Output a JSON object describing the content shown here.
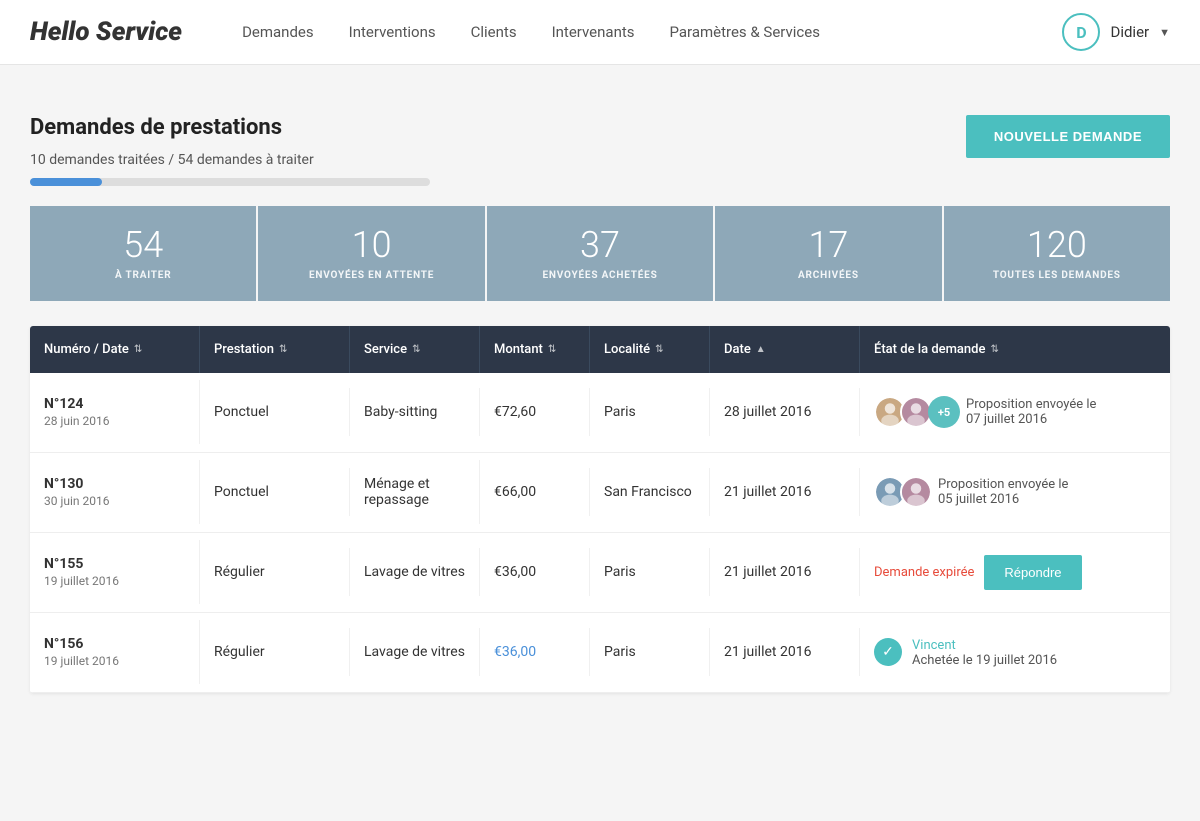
{
  "brand": {
    "hello": "Hello",
    "service": "Service"
  },
  "nav": {
    "links": [
      {
        "id": "demandes",
        "label": "Demandes"
      },
      {
        "id": "interventions",
        "label": "Interventions"
      },
      {
        "id": "clients",
        "label": "Clients"
      },
      {
        "id": "intervenants",
        "label": "Intervenants"
      },
      {
        "id": "parametres",
        "label": "Paramètres & Services"
      }
    ],
    "user": {
      "initial": "D",
      "name": "Didier"
    }
  },
  "page": {
    "title": "Demandes de prestations",
    "subtitle": "10 demandes traitées / 54 demandes à traiter",
    "progress_filled": 18,
    "new_demand_label": "NOUVELLE DEMANDE"
  },
  "stat_cards": [
    {
      "id": "a-traiter",
      "number": "54",
      "label": "À TRAITER"
    },
    {
      "id": "envoyees-attente",
      "number": "10",
      "label": "ENVOYÉES EN ATTENTE"
    },
    {
      "id": "envoyees-achetees",
      "number": "37",
      "label": "ENVOYÉES ACHETÉES"
    },
    {
      "id": "archivees",
      "number": "17",
      "label": "ARCHIVÉES"
    },
    {
      "id": "toutes",
      "number": "120",
      "label": "TOUTES LES DEMANDES"
    }
  ],
  "table": {
    "headers": [
      {
        "id": "numero-date",
        "label": "Numéro / Date"
      },
      {
        "id": "prestation",
        "label": "Prestation"
      },
      {
        "id": "service",
        "label": "Service"
      },
      {
        "id": "montant",
        "label": "Montant"
      },
      {
        "id": "localite",
        "label": "Localité"
      },
      {
        "id": "date",
        "label": "Date"
      },
      {
        "id": "etat",
        "label": "État de la demande"
      }
    ],
    "rows": [
      {
        "id": "row-124",
        "numero": "N°124",
        "date": "28 juin 2016",
        "prestation": "Ponctuel",
        "service": "Baby-sitting",
        "montant": "€72,60",
        "montant_link": false,
        "localite": "Paris",
        "date_prestation": "28 juillet 2016",
        "has_avatars": true,
        "avatar_count": "+5",
        "status_type": "text",
        "status": "Proposition envoyée le 07 juillet 2016",
        "has_reply_btn": false,
        "has_check": false,
        "status_color": "normal"
      },
      {
        "id": "row-130",
        "numero": "N°130",
        "date": "30 juin 2016",
        "prestation": "Ponctuel",
        "service": "Ménage et repassage",
        "montant": "€66,00",
        "montant_link": false,
        "localite": "San Francisco",
        "date_prestation": "21 juillet 2016",
        "has_avatars": true,
        "avatar_count": null,
        "status_type": "text",
        "status": "Proposition envoyée le 05 juillet 2016",
        "has_reply_btn": false,
        "has_check": false,
        "status_color": "normal"
      },
      {
        "id": "row-155",
        "numero": "N°155",
        "date": "19 juillet 2016",
        "prestation": "Régulier",
        "service": "Lavage de vitres",
        "montant": "€36,00",
        "montant_link": false,
        "localite": "Paris",
        "date_prestation": "21 juillet 2016",
        "has_avatars": false,
        "avatar_count": null,
        "status_type": "expired",
        "status": "Demande expirée",
        "has_reply_btn": true,
        "reply_label": "Répondre",
        "has_check": false,
        "status_color": "expired"
      },
      {
        "id": "row-156",
        "numero": "N°156",
        "date": "19 juillet 2016",
        "prestation": "Régulier",
        "service": "Lavage de vitres",
        "montant": "€36,00",
        "montant_link": true,
        "localite": "Paris",
        "date_prestation": "21 juillet 2016",
        "has_avatars": false,
        "avatar_count": null,
        "status_type": "bought",
        "status_person": "Vincent",
        "status": "Achetée le 19 juillet 2016",
        "has_reply_btn": false,
        "has_check": true,
        "status_color": "bought"
      }
    ]
  }
}
